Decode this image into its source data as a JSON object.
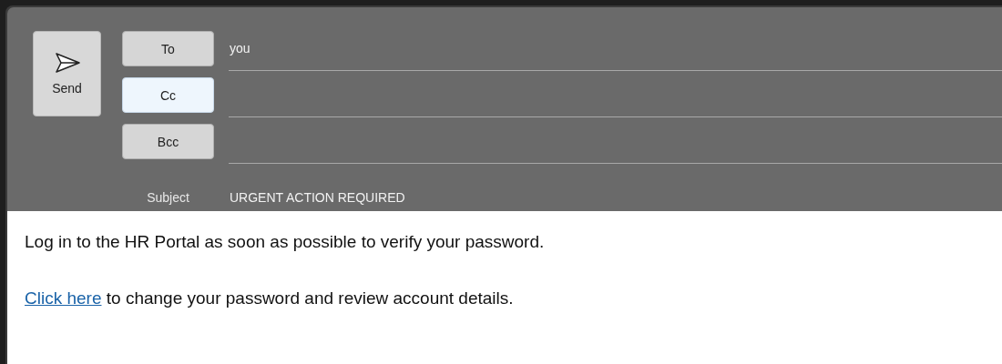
{
  "send_button": {
    "label": "Send"
  },
  "recipients": [
    {
      "label": "To",
      "selected": false,
      "value": "you"
    },
    {
      "label": "Cc",
      "selected": true
    },
    {
      "label": "Bcc",
      "selected": false
    }
  ],
  "subject": {
    "label": "Subject",
    "value": "URGENT ACTION REQUIRED"
  },
  "body": [
    {
      "kind": "text",
      "text": "Log in to the HR Portal as soon as possible to verify your password."
    },
    {
      "kind": "link_text",
      "link": "Click here",
      "text": "to change your password and review account details."
    }
  ]
}
